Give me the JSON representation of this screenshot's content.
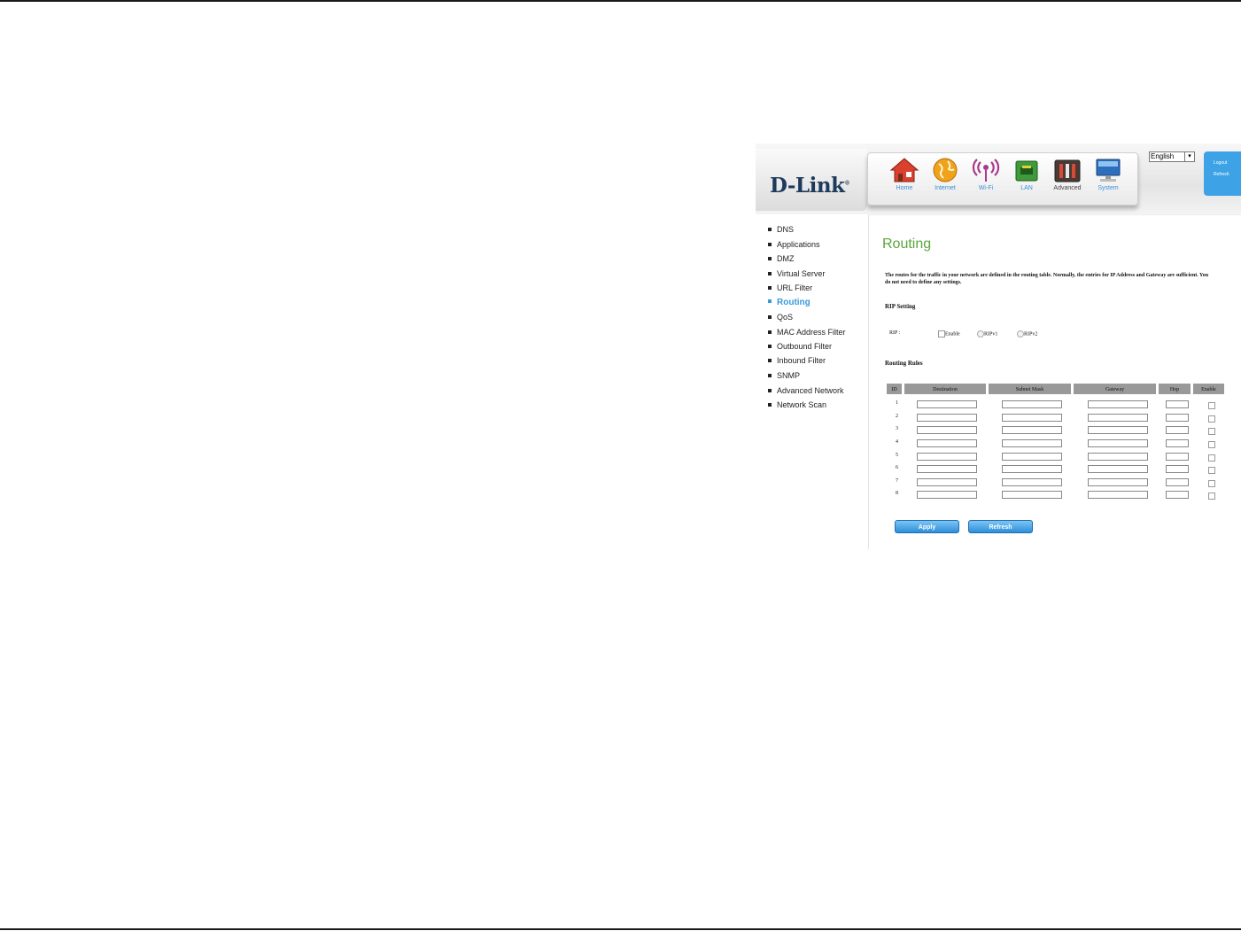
{
  "header": {
    "logo_text": "D-Link",
    "logo_mark": "®",
    "nav": [
      {
        "label": "Home",
        "icon": "home-icon"
      },
      {
        "label": "Internet",
        "icon": "globe-icon"
      },
      {
        "label": "Wi-Fi",
        "icon": "wifi-icon"
      },
      {
        "label": "LAN",
        "icon": "lan-icon"
      },
      {
        "label": "Advanced",
        "icon": "advanced-tools-icon"
      },
      {
        "label": "System",
        "icon": "monitor-icon"
      }
    ],
    "language": "English",
    "side_links": {
      "logout": "Logout",
      "refresh": "Refresh"
    }
  },
  "sidebar": {
    "items": [
      {
        "label": "DNS"
      },
      {
        "label": "Applications"
      },
      {
        "label": "DMZ"
      },
      {
        "label": "Virtual Server"
      },
      {
        "label": "URL Filter"
      },
      {
        "label": "Routing",
        "active": true
      },
      {
        "label": "QoS"
      },
      {
        "label": "MAC Address Filter"
      },
      {
        "label": "Outbound Filter"
      },
      {
        "label": "Inbound Filter"
      },
      {
        "label": "SNMP"
      },
      {
        "label": "Advanced Network"
      },
      {
        "label": "Network Scan"
      }
    ]
  },
  "main": {
    "title": "Routing",
    "description": "The routes for the traffic in your network are defined in the routing table. Normally, the entries for IP Address and Gateway are sufficient. You do not need to define any settings.",
    "rip": {
      "section_title": "RIP Setting",
      "label": "RIP :",
      "enable_label": "Enable",
      "ripv1_label": "RIPv1",
      "ripv2_label": "RIPv2"
    },
    "routing_rules": {
      "section_title": "Routing Rules",
      "columns": [
        "ID",
        "Destination",
        "Subnet Mask",
        "Gateway",
        "Hop",
        "Enable"
      ],
      "rows": [
        {
          "id": "1"
        },
        {
          "id": "2"
        },
        {
          "id": "3"
        },
        {
          "id": "4"
        },
        {
          "id": "5"
        },
        {
          "id": "6"
        },
        {
          "id": "7"
        },
        {
          "id": "8"
        }
      ]
    },
    "buttons": {
      "apply": "Apply",
      "refresh": "Refresh"
    }
  }
}
